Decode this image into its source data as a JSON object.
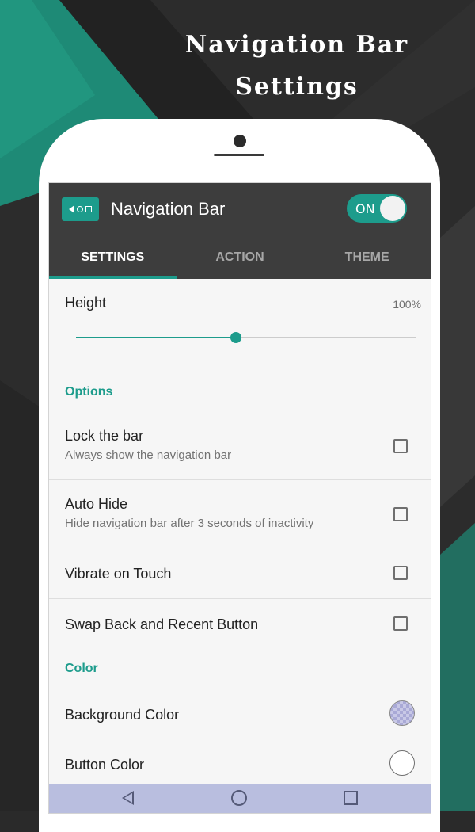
{
  "promo": {
    "title_line1": "Navigation Bar",
    "title_line2": "Settings"
  },
  "colors": {
    "accent": "#1d9c8c",
    "header_bg": "#3d3d3d",
    "screen_bg": "#f6f6f6",
    "navbar_bg": "#b9bedf"
  },
  "header": {
    "icon": "navigation-bar-app-icon",
    "title": "Navigation Bar",
    "toggle_label": "ON"
  },
  "tabs": [
    {
      "label": "SETTINGS",
      "active": true
    },
    {
      "label": "ACTION",
      "active": false
    },
    {
      "label": "THEME",
      "active": false
    }
  ],
  "height": {
    "label": "Height",
    "value_text": "100%",
    "slider_fraction": 0.47
  },
  "options": {
    "section_title": "Options",
    "items": [
      {
        "title": "Lock the bar",
        "subtitle": "Always show the navigation bar",
        "checked": false
      },
      {
        "title": "Auto Hide",
        "subtitle": "Hide navigation bar after 3 seconds of inactivity",
        "checked": false
      },
      {
        "title": "Vibrate on Touch",
        "checked": false
      },
      {
        "title": "Swap Back and Recent Button",
        "checked": false
      }
    ]
  },
  "color": {
    "section_title": "Color",
    "items": [
      {
        "title": "Background Color",
        "swatch": "transparent-checker"
      },
      {
        "title": "Button Color",
        "swatch": "#ffffff"
      }
    ]
  },
  "navbar": {
    "buttons": [
      "back-icon",
      "home-icon",
      "recent-apps-icon"
    ]
  }
}
